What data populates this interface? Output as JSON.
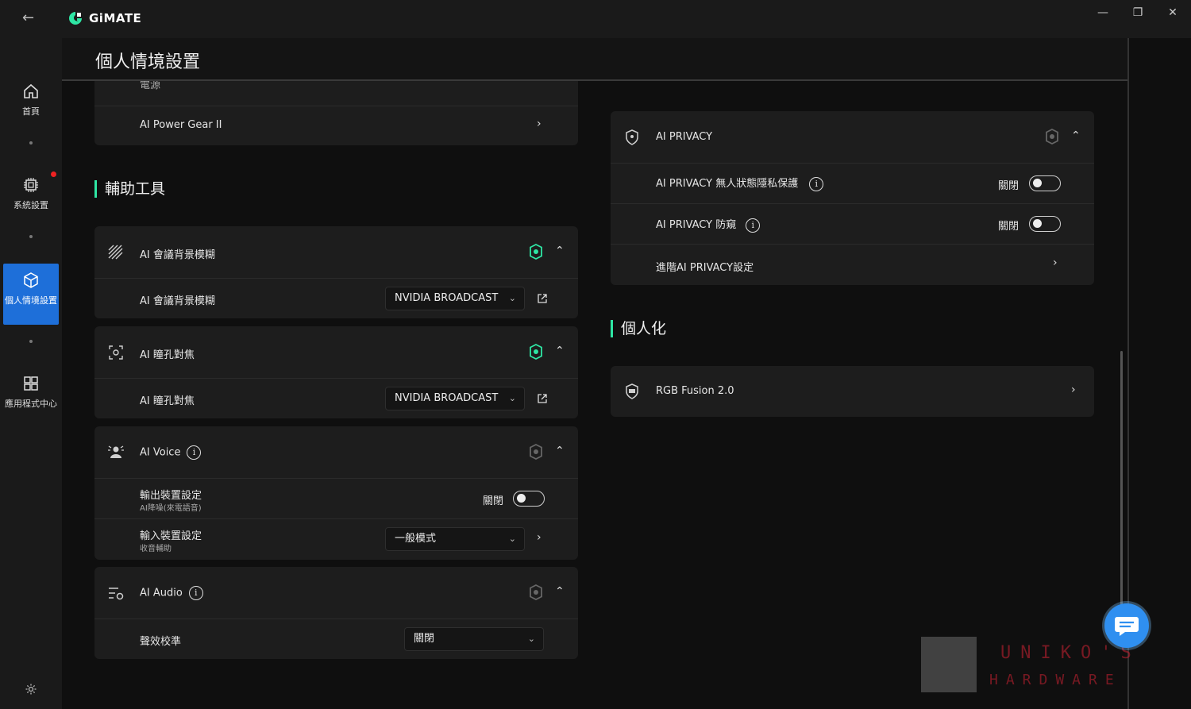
{
  "app": {
    "name": "GiMATE",
    "page_title": "個人情境設置"
  },
  "colors": {
    "accent_green": "#2ee6a4",
    "active_blue": "#1e6fd9",
    "chat_blue": "#2f8ff0"
  },
  "sidebar": {
    "items": [
      {
        "label": "首頁",
        "icon": "home-icon"
      },
      {
        "label": "系統設置",
        "icon": "chip-icon"
      },
      {
        "label": "個人情境設置",
        "icon": "cube-icon"
      },
      {
        "label": "應用程式中心",
        "icon": "grid-icon"
      }
    ]
  },
  "left": {
    "top_card": {
      "partial_label": "電源",
      "row_label": "AI Power Gear II"
    },
    "section_title": "輔助工具",
    "blur": {
      "header": "AI 會議背景模糊",
      "row_label": "AI 會議背景模糊",
      "select_value": "NVIDIA BROADCAST"
    },
    "eye": {
      "header": "AI 瞳孔對焦",
      "row_label": "AI 瞳孔對焦",
      "select_value": "NVIDIA BROADCAST"
    },
    "voice": {
      "header": "AI Voice",
      "output_label": "輸出裝置設定",
      "output_sub": "AI降噪(來電語音)",
      "output_state": "關閉",
      "input_label": "輸入裝置設定",
      "input_sub": "收音輔助",
      "input_select": "一般模式"
    },
    "audio": {
      "header": "AI Audio",
      "row_label": "聲效校準",
      "select_value": "關閉"
    }
  },
  "right": {
    "privacy": {
      "header": "AI PRIVACY",
      "row1_label": "AI PRIVACY 無人狀態隱私保護",
      "row1_state": "關閉",
      "row2_label": "AI PRIVACY 防窺",
      "row2_state": "關閉",
      "row3_label": "進階AI PRIVACY設定"
    },
    "section_title": "個人化",
    "rgb": {
      "label": "RGB Fusion 2.0"
    }
  },
  "watermark": {
    "line1": "UNIKO'S",
    "line2": "HARDWARE"
  },
  "glyphs": {
    "chevron_right": "›",
    "chevron_up": "⌃",
    "chevron_down": "⌄",
    "info": "i",
    "back": "←",
    "minimize": "—",
    "restore": "❐",
    "close": "✕"
  }
}
